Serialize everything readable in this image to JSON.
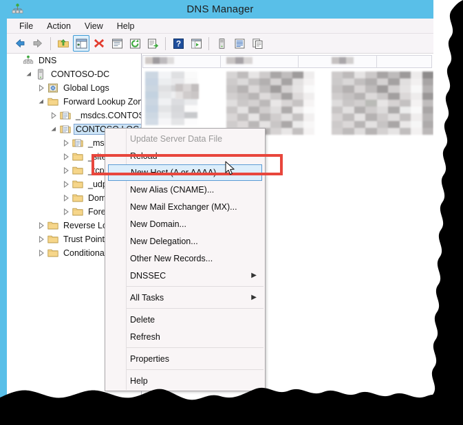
{
  "window": {
    "title": "DNS Manager",
    "app_icon": "dns-server-icon",
    "title_bar_color": "#59bfe8"
  },
  "menu_bar": {
    "items": [
      {
        "label": "File"
      },
      {
        "label": "Action"
      },
      {
        "label": "View"
      },
      {
        "label": "Help"
      }
    ]
  },
  "toolbar": {
    "buttons": [
      {
        "name": "back-arrow-icon",
        "glyph": "back",
        "selected": false
      },
      {
        "name": "forward-arrow-icon",
        "glyph": "forward",
        "selected": false
      },
      {
        "name": "up-one-level-icon",
        "glyph": "up-folder",
        "selected": false
      },
      {
        "name": "show-hide-console-tree-icon",
        "glyph": "tree-pane",
        "selected": true
      },
      {
        "name": "delete-icon",
        "glyph": "red-x",
        "selected": false
      },
      {
        "name": "properties-icon",
        "glyph": "properties",
        "selected": false
      },
      {
        "name": "refresh-icon",
        "glyph": "refresh",
        "selected": false
      },
      {
        "name": "export-list-icon",
        "glyph": "export",
        "selected": false
      },
      {
        "name": "help-icon",
        "glyph": "question",
        "selected": false
      },
      {
        "name": "show-help-topics-icon",
        "glyph": "help-window",
        "selected": false
      },
      {
        "name": "new-server-icon",
        "glyph": "server",
        "selected": false
      },
      {
        "name": "list-view-icon",
        "glyph": "list",
        "selected": false
      },
      {
        "name": "copy-icon",
        "glyph": "copy",
        "selected": false
      }
    ]
  },
  "tree": {
    "nodes": [
      {
        "label": "DNS",
        "indent": 0,
        "twisty": "none",
        "icon": "dns-root-icon",
        "selected": false
      },
      {
        "label": "CONTOSO-DC",
        "indent": 1,
        "twisty": "expanded",
        "icon": "server-icon",
        "selected": false
      },
      {
        "label": "Global Logs",
        "indent": 2,
        "twisty": "collapsed",
        "icon": "global-logs-icon",
        "selected": false
      },
      {
        "label": "Forward Lookup Zones",
        "indent": 2,
        "twisty": "expanded",
        "icon": "folder-icon",
        "selected": false
      },
      {
        "label": "_msdcs.CONTOSO.LOCAL",
        "indent": 3,
        "twisty": "collapsed",
        "icon": "zone-icon",
        "selected": false
      },
      {
        "label": "CONTOSO.LOCAL",
        "indent": 3,
        "twisty": "expanded",
        "icon": "zone-icon",
        "selected": true
      },
      {
        "label": "_msdcs",
        "indent": 4,
        "twisty": "collapsed",
        "icon": "zone-icon",
        "selected": false
      },
      {
        "label": "_sites",
        "indent": 4,
        "twisty": "collapsed",
        "icon": "folder-icon",
        "selected": false
      },
      {
        "label": "_tcp",
        "indent": 4,
        "twisty": "collapsed",
        "icon": "folder-icon",
        "selected": false
      },
      {
        "label": "_udp",
        "indent": 4,
        "twisty": "collapsed",
        "icon": "folder-icon",
        "selected": false
      },
      {
        "label": "DomainDnsZones",
        "indent": 4,
        "twisty": "collapsed",
        "icon": "folder-icon",
        "selected": false
      },
      {
        "label": "ForestDnsZones",
        "indent": 4,
        "twisty": "collapsed",
        "icon": "folder-icon",
        "selected": false
      },
      {
        "label": "Reverse Lookup Zones",
        "indent": 2,
        "twisty": "collapsed",
        "icon": "folder-icon",
        "selected": false
      },
      {
        "label": "Trust Points",
        "indent": 2,
        "twisty": "collapsed",
        "icon": "folder-icon",
        "selected": false
      },
      {
        "label": "Conditional Forwarders",
        "indent": 2,
        "twisty": "collapsed",
        "icon": "folder-icon",
        "selected": false
      }
    ]
  },
  "list_pane": {
    "content_state": "blurred",
    "description": "DNS records list view with blurred/redacted rows"
  },
  "context_menu": {
    "items": [
      {
        "label": "Update Server Data File",
        "disabled": true,
        "submenu": false,
        "highlighted": false,
        "separator_after": false
      },
      {
        "label": "Reload",
        "disabled": false,
        "submenu": false,
        "highlighted": false,
        "separator_after": false
      },
      {
        "label": "New Host (A or AAAA)...",
        "disabled": false,
        "submenu": false,
        "highlighted": true,
        "separator_after": false
      },
      {
        "label": "New Alias (CNAME)...",
        "disabled": false,
        "submenu": false,
        "highlighted": false,
        "separator_after": false
      },
      {
        "label": "New Mail Exchanger (MX)...",
        "disabled": false,
        "submenu": false,
        "highlighted": false,
        "separator_after": false
      },
      {
        "label": "New Domain...",
        "disabled": false,
        "submenu": false,
        "highlighted": false,
        "separator_after": false
      },
      {
        "label": "New Delegation...",
        "disabled": false,
        "submenu": false,
        "highlighted": false,
        "separator_after": false
      },
      {
        "label": "Other New Records...",
        "disabled": false,
        "submenu": false,
        "highlighted": false,
        "separator_after": false
      },
      {
        "label": "DNSSEC",
        "disabled": false,
        "submenu": true,
        "highlighted": false,
        "separator_after": true
      },
      {
        "label": "All Tasks",
        "disabled": false,
        "submenu": true,
        "highlighted": false,
        "separator_after": true
      },
      {
        "label": "Delete",
        "disabled": false,
        "submenu": false,
        "highlighted": false,
        "separator_after": false
      },
      {
        "label": "Refresh",
        "disabled": false,
        "submenu": false,
        "highlighted": false,
        "separator_after": true
      },
      {
        "label": "Properties",
        "disabled": false,
        "submenu": false,
        "highlighted": false,
        "separator_after": true
      },
      {
        "label": "Help",
        "disabled": false,
        "submenu": false,
        "highlighted": false,
        "separator_after": false
      }
    ],
    "submenu_arrow_glyph": "▶"
  },
  "annotation": {
    "shape": "rectangle",
    "color": "#e8463c",
    "targets": "New Host (A or AAAA)..."
  },
  "cursor": {
    "type": "arrow-pointer"
  },
  "decoration": {
    "torn_edges": [
      "right",
      "bottom"
    ],
    "torn_color": "#000000"
  }
}
